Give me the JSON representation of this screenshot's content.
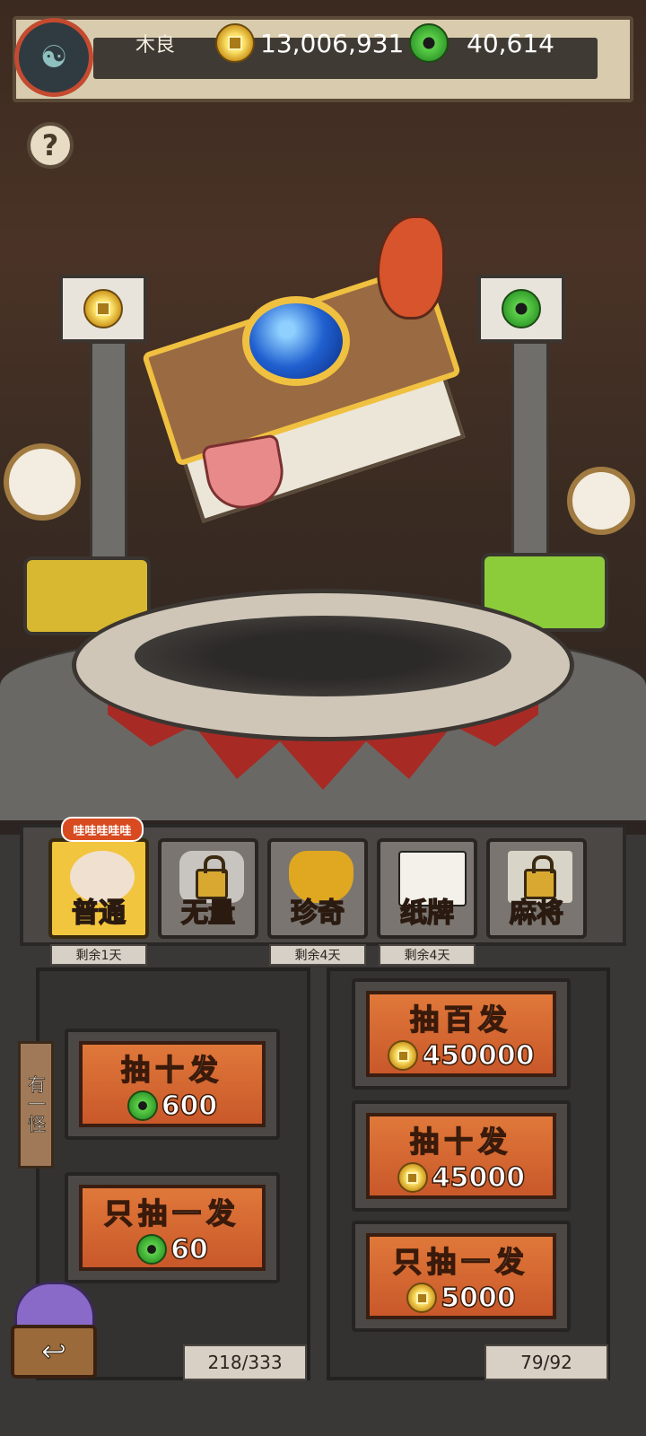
{
  "header": {
    "player_name": "木良",
    "gold_amount": "13,006,931",
    "jade_amount": "40,614",
    "help_label": "?"
  },
  "tabs": [
    {
      "label": "普通",
      "active": true,
      "locked": false,
      "badge": "哇哇哇哇哇",
      "remaining": "剩余1天"
    },
    {
      "label": "无量",
      "active": false,
      "locked": true,
      "badge": "",
      "remaining": ""
    },
    {
      "label": "珍奇",
      "active": false,
      "locked": false,
      "badge": "",
      "remaining": "剩余4天"
    },
    {
      "label": "纸牌",
      "active": false,
      "locked": false,
      "badge": "",
      "remaining": "剩余4天"
    },
    {
      "label": "麻将",
      "active": false,
      "locked": true,
      "badge": "",
      "remaining": ""
    }
  ],
  "side_tab": "有一怪",
  "left_column": {
    "buttons": [
      {
        "title": "抽十发",
        "currency": "jade",
        "cost": "600"
      },
      {
        "title": "只抽一发",
        "currency": "jade",
        "cost": "60"
      }
    ],
    "counter": "218/333"
  },
  "right_column": {
    "buttons": [
      {
        "title": "抽百发",
        "currency": "gold",
        "cost": "450000"
      },
      {
        "title": "抽十发",
        "currency": "gold",
        "cost": "45000"
      },
      {
        "title": "只抽一发",
        "currency": "gold",
        "cost": "5000"
      }
    ],
    "counter": "79/92"
  },
  "colors": {
    "active_tab": "#f2c53f",
    "draw_button": "#d8682e",
    "gold": "#e8b830",
    "jade": "#3ab030"
  }
}
